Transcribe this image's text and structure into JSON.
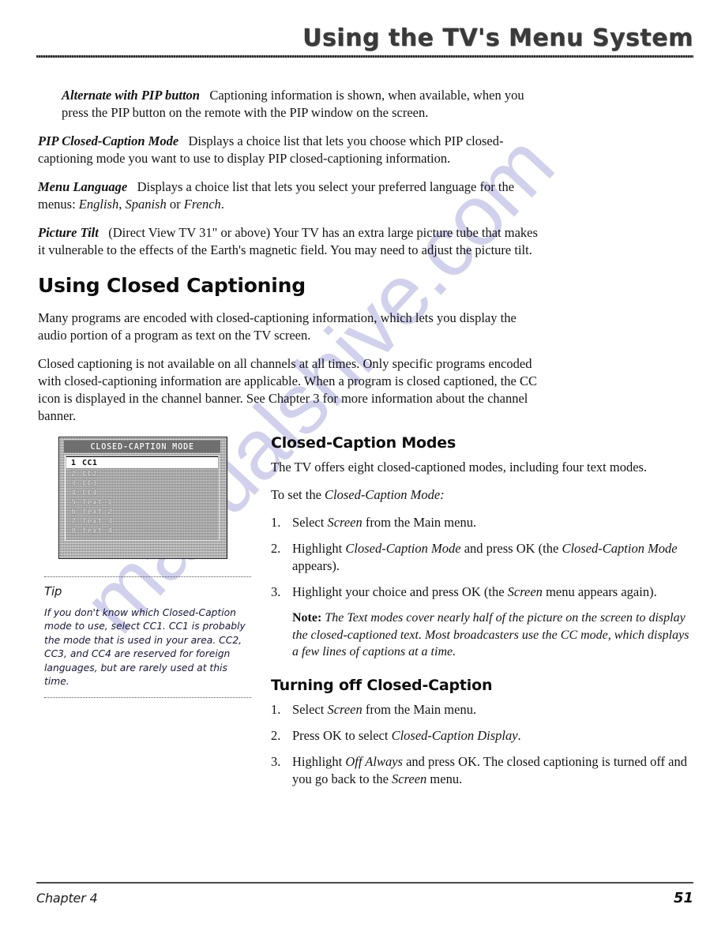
{
  "header": {
    "title": "Using the TV's Menu System"
  },
  "intro": {
    "paragraphs": [
      {
        "lead": "Alternate with PIP button",
        "body": "Captioning information is shown, when available, when you press the PIP button on the remote with the PIP window on the screen.",
        "indent": true
      },
      {
        "lead": "PIP Closed-Caption Mode",
        "body": "Displays a choice list that lets you choose which PIP closed-captioning mode you want to use to display PIP closed-captioning information.",
        "indent": false
      },
      {
        "lead": "Menu Language",
        "body": "Displays a choice list that lets you select your preferred language for the menus: English, Spanish or French.",
        "indent": false
      },
      {
        "lead": "Picture Tilt",
        "body": "(Direct View TV 31\" or above) Your TV has an extra large picture tube that makes it vulnerable to the effects of the Earth's magnetic field. You may need to adjust the picture tilt.",
        "indent": false
      }
    ]
  },
  "section": {
    "title": "Using Closed Captioning",
    "paragraph_1": "Many programs are encoded with closed-captioning information, which lets you display the audio portion of a program as text on the TV screen.",
    "paragraph_2": "Closed captioning is not available on all channels at all times. Only specific programs encoded with closed-captioning information are applicable. When a program is closed captioned, the CC icon is displayed in the channel banner. See Chapter 3 for more information about the channel banner."
  },
  "figure": {
    "menu_title": "CLOSED-CAPTION MODE",
    "items": [
      {
        "num": "1",
        "label": "CC1",
        "selected": true
      },
      {
        "num": "2",
        "label": "CC2",
        "selected": false
      },
      {
        "num": "3",
        "label": "CC3",
        "selected": false
      },
      {
        "num": "4",
        "label": "CC4",
        "selected": false
      },
      {
        "num": "5",
        "label": "Text 1",
        "selected": false
      },
      {
        "num": "6",
        "label": "Text 2",
        "selected": false
      },
      {
        "num": "7",
        "label": "Text 3",
        "selected": false
      },
      {
        "num": "8",
        "label": "Text 4",
        "selected": false
      }
    ]
  },
  "tip": {
    "title": "Tip",
    "text": "If you don't know which Closed-Caption mode to use, select CC1. CC1 is probably the mode that is used in your area. CC2, CC3, and CC4 are reserved for foreign languages, but are rarely used at this time."
  },
  "modes": {
    "heading": "Closed-Caption Modes",
    "intro": "The TV offers eight closed-captioned modes, including four text modes.",
    "lead_in": "To set the Closed-Caption Mode:",
    "steps": [
      {
        "num": "1.",
        "text": "Select Screen from the Main menu."
      },
      {
        "num": "2.",
        "text": "Highlight Closed-Caption Mode and press OK  (the Closed-Caption Mode appears)."
      },
      {
        "num": "3.",
        "text": "Highlight your choice and press OK (the Screen menu appears again)."
      }
    ],
    "note_label": "Note:",
    "note_text": "The Text modes cover nearly half of the picture on the screen to display the closed-captioned text. Most broadcasters use the CC mode, which displays a few lines of captions at a time."
  },
  "turning_off": {
    "heading": "Turning off Closed-Caption",
    "steps": [
      {
        "num": "1.",
        "text": "Select Screen from the Main menu."
      },
      {
        "num": "2.",
        "text": "Press OK to select Closed-Caption Display."
      },
      {
        "num": "3.",
        "text": "Highlight Off Always and press OK. The closed captioning is turned off and you go back to the Screen menu."
      }
    ]
  },
  "footer": {
    "chapter": "Chapter 4",
    "page": "51"
  },
  "watermark": {
    "text": "manualshive.com"
  },
  "colors": {
    "watermark": "#c9c9ea",
    "text": "#141414",
    "rule": "#2b2b2b"
  }
}
